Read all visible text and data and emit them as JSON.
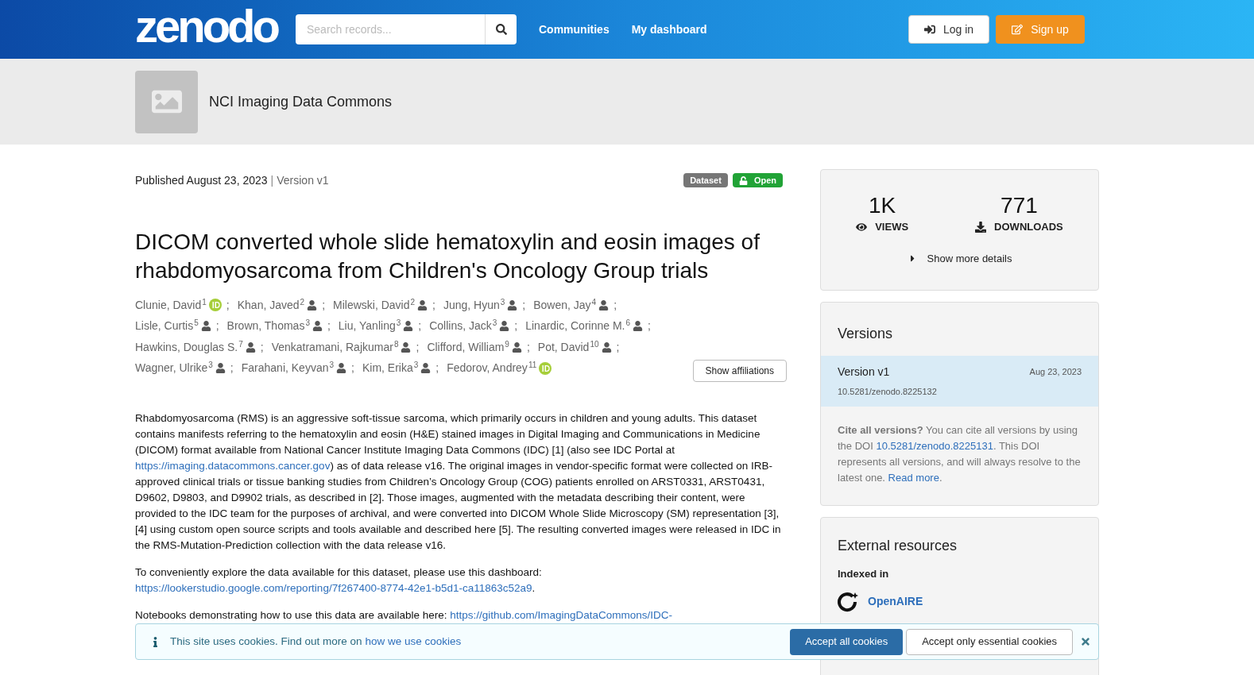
{
  "header": {
    "logo": "zenodo",
    "search": {
      "placeholder": "Search records..."
    },
    "nav": [
      "Communities",
      "My dashboard"
    ],
    "login": "Log in",
    "signup": "Sign up"
  },
  "community": {
    "name": "NCI Imaging Data Commons"
  },
  "record": {
    "published": "Published August 23, 2023",
    "divider": "|",
    "version": "Version v1",
    "author_separator": ";",
    "badges": [
      {
        "kind": "type",
        "label": "Dataset"
      },
      {
        "kind": "access",
        "label": "Open"
      }
    ],
    "title": "DICOM converted whole slide hematoxylin and eosin images of rhabdomyosarcoma from Children's Oncology Group trials",
    "author_rows": [
      [
        {
          "name": "Clunie, David",
          "sup": "1",
          "kind": "orcid"
        },
        {
          "name": "Khan, Javed",
          "sup": "2",
          "kind": "person"
        },
        {
          "name": "Milewski, David",
          "sup": "2",
          "kind": "person"
        },
        {
          "name": "Jung, Hyun",
          "sup": "3",
          "kind": "person"
        },
        {
          "name": "Bowen, Jay",
          "sup": "4",
          "kind": "person"
        }
      ],
      [
        {
          "name": "Lisle, Curtis",
          "sup": "5",
          "kind": "person"
        },
        {
          "name": "Brown, Thomas",
          "sup": "3",
          "kind": "person"
        },
        {
          "name": "Liu, Yanling",
          "sup": "3",
          "kind": "person"
        },
        {
          "name": "Collins, Jack",
          "sup": "3",
          "kind": "person"
        },
        {
          "name": "Linardic, Corinne M.",
          "sup": "6",
          "kind": "person"
        }
      ],
      [
        {
          "name": "Hawkins, Douglas S.",
          "sup": "7",
          "kind": "person"
        },
        {
          "name": "Venkatramani, Rajkumar",
          "sup": "8",
          "kind": "person"
        },
        {
          "name": "Clifford, William",
          "sup": "9",
          "kind": "person"
        },
        {
          "name": "Pot, David",
          "sup": "10",
          "kind": "person"
        }
      ],
      [
        {
          "name": "Wagner, Ulrike",
          "sup": "3",
          "kind": "person"
        },
        {
          "name": "Farahani, Keyvan",
          "sup": "3",
          "kind": "person"
        },
        {
          "name": "Kim, Erika",
          "sup": "3",
          "kind": "person"
        },
        {
          "name": "Fedorov, Andrey",
          "sup": "11",
          "kind": "orcid"
        }
      ]
    ],
    "show_affiliations": "Show affiliations",
    "description": [
      [
        {
          "text": "Rhabdomyosarcoma (RMS) is an aggressive soft-tissue sarcoma, which primarily occurs in children and young adults. This dataset contains manifests referring to the hematoxylin and eosin (H&E) stained images in Digital Imaging and Communications in Medicine (DICOM) format available from National Cancer Institute Imaging Data Commons (IDC) [1] (also see IDC Portal at ",
          "kind": "plain"
        },
        {
          "text": "https://imaging.datacommons.cancer.gov",
          "kind": "link"
        },
        {
          "text": ") as of data release v16. The original images in vendor-specific format were collected on IRB-approved clinical trials or tissue banking studies from Children’s Oncology Group (COG) patients enrolled on ARST0331, ARST0431, D9602, D9803, and D9902 trials, as described in [2]. Those images, augmented with the metadata describing their content, were provided to the IDC team for the purposes of archival, and were converted into DICOM Whole Slide Microscopy (SM) representation [3], [4] using custom open source scripts and tools available and described here [5]. The resulting converted images were released in IDC in the RMS-Mutation-Prediction collection with the data release v16.",
          "kind": "plain"
        }
      ],
      [
        {
          "text": "To conveniently explore the data available for this dataset, please use this dashboard: ",
          "kind": "plain"
        },
        {
          "text": "https://lookerstudio.google.com/reporting/7f267400-8774-42e1-b5d1-ca11863c52a9",
          "kind": "link"
        },
        {
          "text": ".",
          "kind": "plain"
        }
      ],
      [
        {
          "text": "Notebooks demonstrating how to use this data are available here: ",
          "kind": "plain"
        },
        {
          "text": "https://github.com/ImagingDataCommons/IDC-",
          "kind": "link"
        }
      ]
    ]
  },
  "stats": {
    "views": {
      "value": "1K",
      "label": "VIEWS"
    },
    "downloads": {
      "value": "771",
      "label": "DOWNLOADS"
    },
    "more": "Show more details"
  },
  "versions": {
    "title": "Versions",
    "items": [
      {
        "label": "Version v1",
        "date": "Aug 23, 2023",
        "doi": "10.5281/zenodo.8225132",
        "selected": true
      }
    ],
    "cite": [
      {
        "text": "Cite all versions?",
        "kind": "bold"
      },
      {
        "text": " You can cite all versions by using the DOI ",
        "kind": "plain"
      },
      {
        "text": "10.5281/zenodo.8225131",
        "kind": "link"
      },
      {
        "text": ". This DOI represents all versions, and will always resolve to the latest one. ",
        "kind": "plain"
      },
      {
        "text": "Read more",
        "kind": "link"
      },
      {
        "text": ".",
        "kind": "plain"
      }
    ]
  },
  "external": {
    "title": "External resources",
    "subtitle": "Indexed in",
    "items": [
      "OpenAIRE"
    ]
  },
  "cookies": {
    "text": "This site uses cookies. Find out more on ",
    "link": "how we use cookies",
    "accept_all": "Accept all cookies",
    "accept_essential": "Accept only essential cookies"
  }
}
